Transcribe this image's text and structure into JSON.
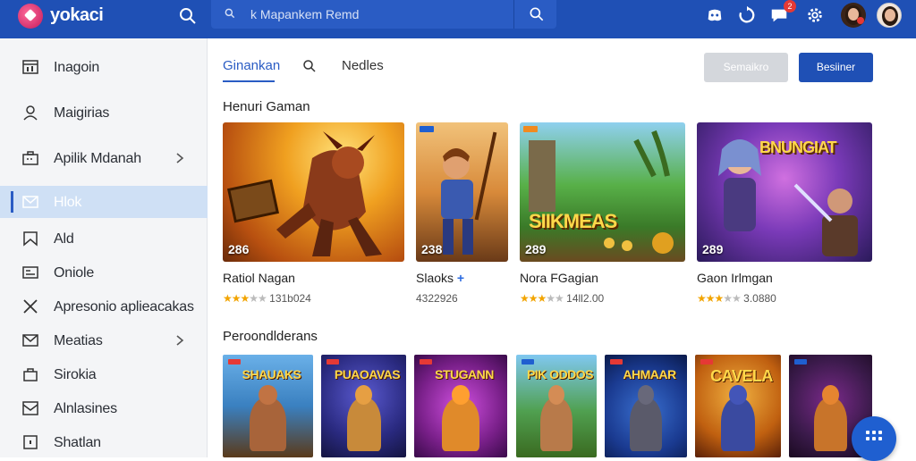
{
  "app": {
    "brand": "yokaci"
  },
  "search": {
    "placeholder": "k Mapankem Remd"
  },
  "topbar": {
    "notification_count": "2"
  },
  "sidebar": {
    "items": [
      {
        "label": "Inagoin",
        "icon": "dashboard-icon"
      },
      {
        "label": "Maigirias",
        "icon": "user-icon"
      },
      {
        "label": "Apilik Mdanah",
        "icon": "briefcase-icon",
        "has_arrow": true
      },
      {
        "label": "Hlok",
        "icon": "mail-icon",
        "active": true
      },
      {
        "label": "Ald",
        "icon": "bookmark-icon"
      },
      {
        "label": "Oniole",
        "icon": "card-icon"
      },
      {
        "label": "Apresonio aplieacakas",
        "icon": "tools-icon"
      },
      {
        "label": "Meatias",
        "icon": "envelope-icon",
        "has_arrow": true
      },
      {
        "label": "Sirokia",
        "icon": "bag-icon"
      },
      {
        "label": "Alnlasines",
        "icon": "inbox-icon"
      },
      {
        "label": "Shatlan",
        "icon": "square-icon"
      }
    ]
  },
  "tabs": [
    {
      "label": "Ginankan",
      "active": true
    },
    {
      "label": "Nedles",
      "active": false
    }
  ],
  "buttons": {
    "secondary": "Semaikro",
    "primary": "Besiiner"
  },
  "sections": {
    "featured": "Henuri Gaman",
    "recommended": "Peroondlderans"
  },
  "featured": [
    {
      "name": "Ratiol Nagan",
      "count": "286",
      "rating_text": "131b024",
      "stars": 3,
      "art_title": ""
    },
    {
      "name": "Slaoks",
      "count": "238",
      "rating_text": "4322926",
      "stars": 0,
      "art_title": "",
      "plus": "+"
    },
    {
      "name": "Nora FGagian",
      "count": "289",
      "rating_text": "14ll2.00",
      "stars": 3,
      "art_title": "SIIKMEAS"
    },
    {
      "name": "Gaon Irlmgan",
      "count": "289",
      "rating_text": "3.0880",
      "stars": 3,
      "art_title": "BNUNGIAT"
    }
  ],
  "recommended": [
    {
      "label": "SHAUAKS"
    },
    {
      "label": "PUAOAVAS"
    },
    {
      "label": "STUGANN"
    },
    {
      "label": "PIK ODDOS"
    },
    {
      "label": "AHMAAR"
    },
    {
      "label": "CAVELA"
    },
    {
      "label": ""
    }
  ],
  "colors": {
    "brand": "#1f50b5",
    "active_nav": "#cfe0f5",
    "star": "#f2a400"
  }
}
